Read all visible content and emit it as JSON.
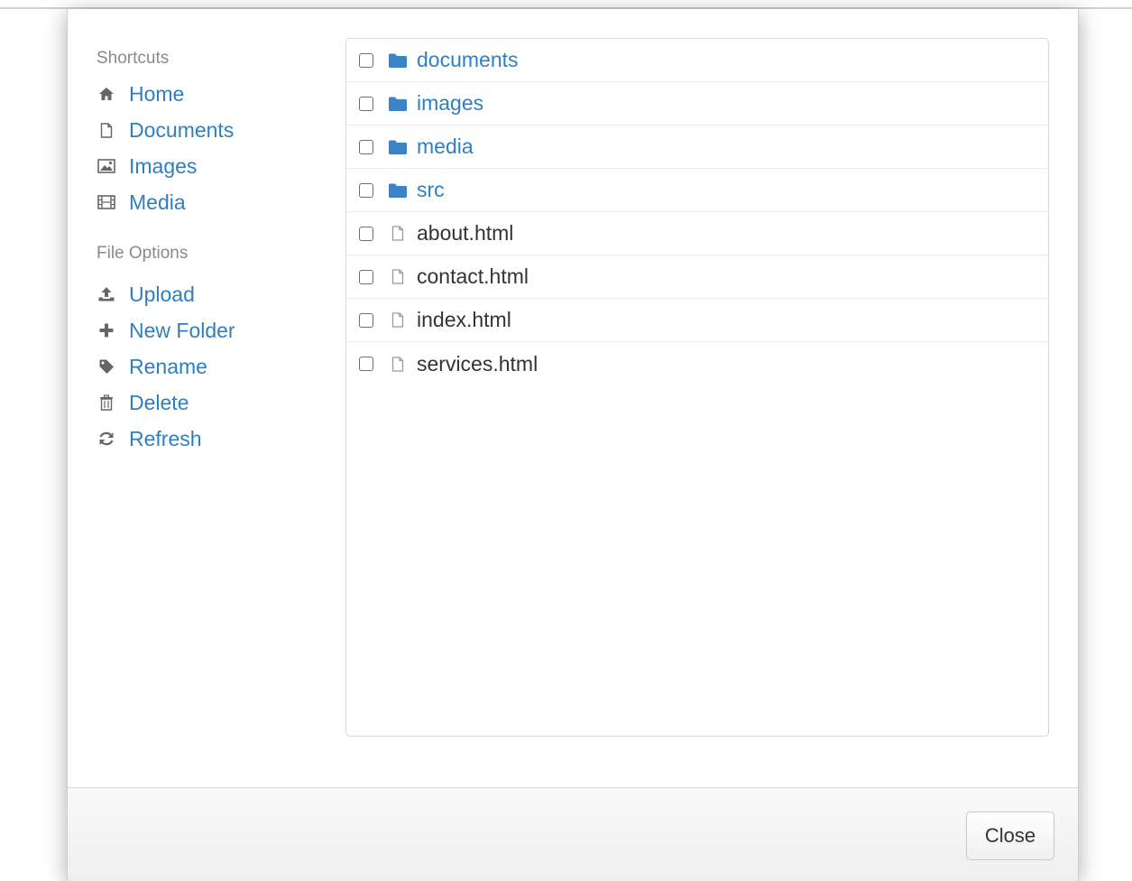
{
  "sidebar": {
    "shortcuts_title": "Shortcuts",
    "shortcuts": [
      {
        "label": "Home",
        "icon": "home-icon"
      },
      {
        "label": "Documents",
        "icon": "document-icon"
      },
      {
        "label": "Images",
        "icon": "image-icon"
      },
      {
        "label": "Media",
        "icon": "film-icon"
      }
    ],
    "file_options_title": "File Options",
    "file_options": [
      {
        "label": "Upload",
        "icon": "upload-icon"
      },
      {
        "label": "New Folder",
        "icon": "plus-icon"
      },
      {
        "label": "Rename",
        "icon": "tag-icon"
      },
      {
        "label": "Delete",
        "icon": "trash-icon"
      },
      {
        "label": "Refresh",
        "icon": "refresh-icon"
      }
    ]
  },
  "files": [
    {
      "name": "documents",
      "type": "folder",
      "checked": false
    },
    {
      "name": "images",
      "type": "folder",
      "checked": false
    },
    {
      "name": "media",
      "type": "folder",
      "checked": false
    },
    {
      "name": "src",
      "type": "folder",
      "checked": false
    },
    {
      "name": "about.html",
      "type": "file",
      "checked": false
    },
    {
      "name": "contact.html",
      "type": "file",
      "checked": false
    },
    {
      "name": "index.html",
      "type": "file",
      "checked": false
    },
    {
      "name": "services.html",
      "type": "file",
      "checked": false
    }
  ],
  "footer": {
    "close_label": "Close"
  },
  "colors": {
    "link": "#2f7fc0",
    "folder": "#3b83c6",
    "text": "#333333",
    "muted": "#8a8a8a"
  }
}
